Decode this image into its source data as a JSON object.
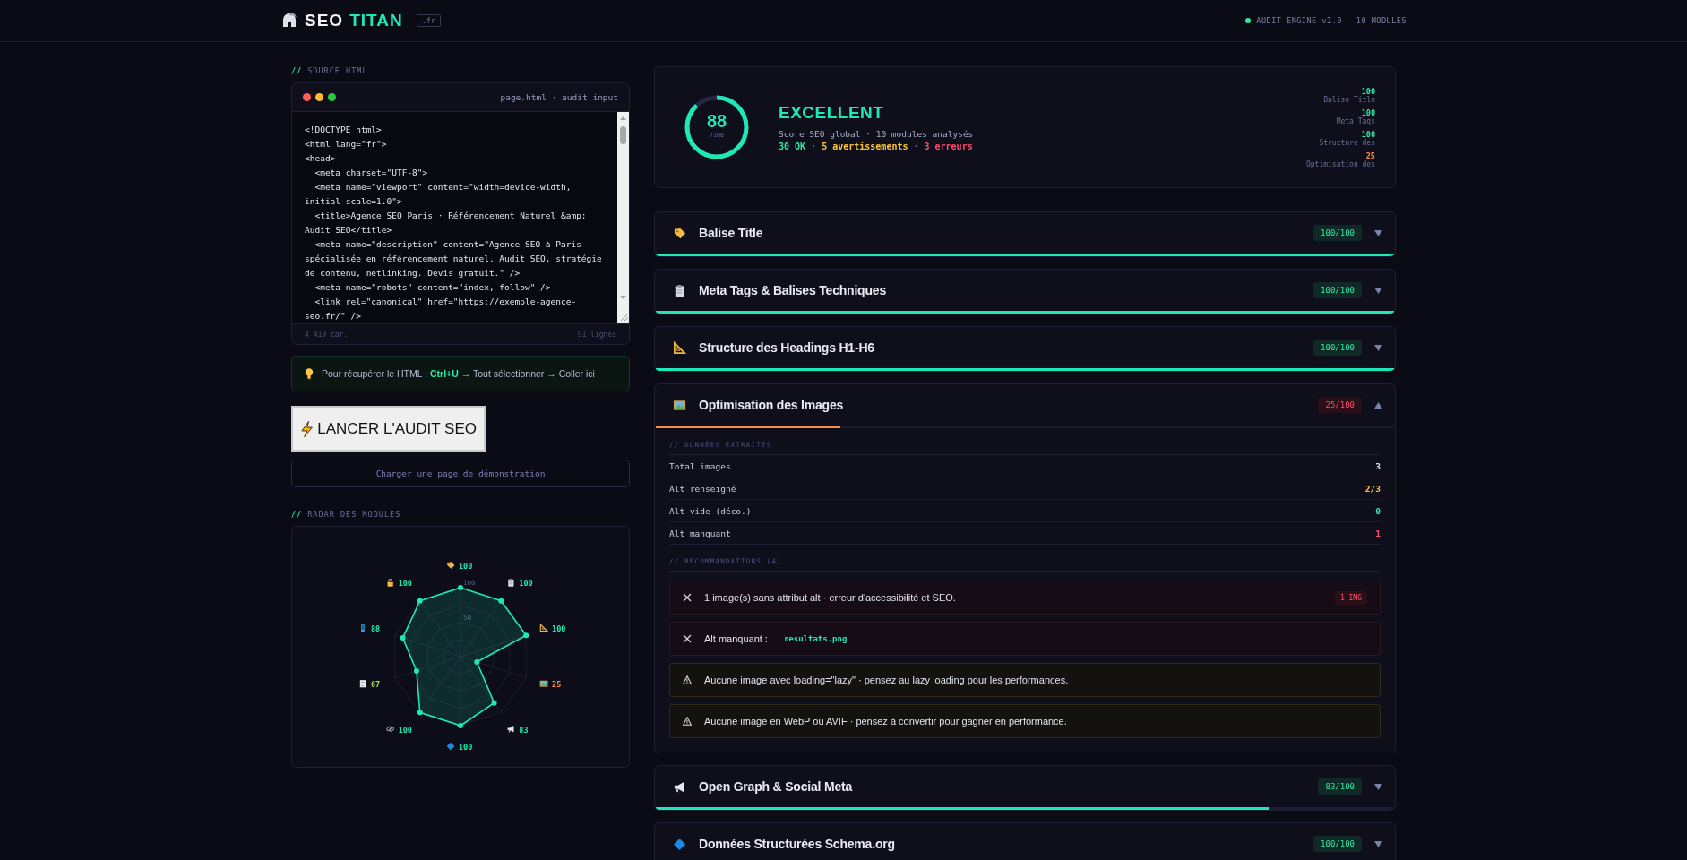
{
  "header": {
    "logo_primary": "SEO",
    "logo_accent": "TITAN",
    "domain_badge": ".fr",
    "engine_status": {
      "online": true,
      "label": "AUDIT ENGINE v2.0"
    },
    "modules_count": "10 MODULES"
  },
  "source": {
    "section_prefix": "//",
    "section_label": "SOURCE HTML",
    "filename": "page.html · audit input",
    "lines": [
      "<!DOCTYPE html>",
      "<html lang=\"fr\">",
      "<head>",
      "  <meta charset=\"UTF-8\">",
      "  <meta name=\"viewport\" content=\"width=device-width,",
      "initial-scale=1.0\">",
      "  <title>Agence SEO Paris · Référencement Naturel &amp;",
      "Audit SEO</title>",
      "  <meta name=\"description\" content=\"Agence SEO à Paris",
      "spécialisée en référencement naturel. Audit SEO, stratégie",
      "de contenu, netlinking. Devis gratuit.\" />",
      "  <meta name=\"robots\" content=\"index, follow\" />",
      "  <link rel=\"canonical\" href=\"https://exemple-agence-",
      "seo.fr/\" />"
    ],
    "char_count": "4 419 car.",
    "line_count": "91 lignes"
  },
  "hint": {
    "text": "Pour récupérer le HTML : **Ctrl+U** → Tout sélectionner → Coller ici"
  },
  "run_button": {
    "label": "LANCER L'AUDIT SEO"
  },
  "demo_button": {
    "label": "Charger une page de démonstration"
  },
  "radar": {
    "section_prefix": "//",
    "section_label": "RADAR DES MODULES",
    "ring_labels": [
      "100",
      "50"
    ],
    "modules": [
      {
        "value": "100",
        "color": "#1de9b6"
      },
      {
        "value": "100",
        "color": "#1de9b6"
      },
      {
        "value": "100",
        "color": "#1de9b6"
      },
      {
        "value": "25",
        "color": "#ff8c42"
      },
      {
        "value": "83",
        "color": "#1de9b6"
      },
      {
        "value": "100",
        "color": "#1de9b6"
      },
      {
        "value": "100",
        "color": "#1de9b6"
      },
      {
        "value": "67",
        "color": "#9be15d"
      },
      {
        "value": "88",
        "color": "#1de9b6"
      },
      {
        "value": "100",
        "color": "#1de9b6"
      }
    ]
  },
  "score": {
    "value": "88",
    "max": "/100",
    "level": 0.88,
    "verdict": "EXCELLENT",
    "summary": "Score SEO global · 10 modules analysés",
    "separator": "·",
    "stats": [
      {
        "text": "30 OK",
        "color": "#2ee8a5"
      },
      {
        "text": "5 avertissements",
        "color": "#ffc53d"
      },
      {
        "text": "3 erreurs",
        "color": "#ff4d6a"
      }
    ],
    "subscores": [
      {
        "value": "100",
        "label": "Balise Title",
        "color": "#2ee8a5"
      },
      {
        "value": "100",
        "label": "Meta Tags",
        "color": "#2ee8a5"
      },
      {
        "value": "100",
        "label": "Structure des",
        "color": "#2ee8a5"
      },
      {
        "value": "25",
        "label": "Optimisation des",
        "color": "#ff8c42"
      }
    ]
  },
  "modules": [
    {
      "title": "Balise Title",
      "score": "100/100",
      "kind": "pass",
      "level": 1,
      "expanded": false
    },
    {
      "title": "Meta Tags & Balises Techniques",
      "score": "100/100",
      "kind": "pass",
      "level": 1,
      "expanded": false
    },
    {
      "title": "Structure des Headings H1-H6",
      "score": "100/100",
      "kind": "pass",
      "level": 1,
      "expanded": false
    },
    {
      "title": "Optimisation des Images",
      "score": "25/100",
      "kind": "fail",
      "level": 0.25,
      "expanded": true,
      "details": {
        "data_heading": "// DONNÉES EXTRAITES",
        "rows": [
          {
            "label": "Total images",
            "value": "3",
            "color": "#e4e6f2"
          },
          {
            "label": "Alt renseigné",
            "value": "2/3",
            "color": "#ffc53d"
          },
          {
            "label": "Alt vide (déco.)",
            "value": "0",
            "color": "#2ee8a5"
          },
          {
            "label": "Alt manquant",
            "value": "1",
            "color": "#ff4d6a"
          }
        ],
        "recs_heading": "// RECOMMANDATIONS (4)",
        "recommendations": [
          {
            "kind": "error",
            "text": "1 image(s) sans attribut alt · erreur d'accessibilité et SEO.",
            "badge": "1 IMG"
          },
          {
            "kind": "error",
            "text": "Alt manquant :",
            "code": "resultats.png"
          },
          {
            "kind": "warning",
            "text": "Aucune image avec loading=\"lazy\" · pensez au lazy loading pour les performances."
          },
          {
            "kind": "warning",
            "text": "Aucune image en WebP ou AVIF · pensez à convertir pour gagner en performance."
          }
        ]
      }
    },
    {
      "title": "Open Graph & Social Meta",
      "score": "83/100",
      "kind": "pass",
      "level": 0.83,
      "expanded": false
    },
    {
      "title": "Données Structurées Schema.org",
      "score": "100/100",
      "kind": "pass",
      "expanded": false
    }
  ]
}
